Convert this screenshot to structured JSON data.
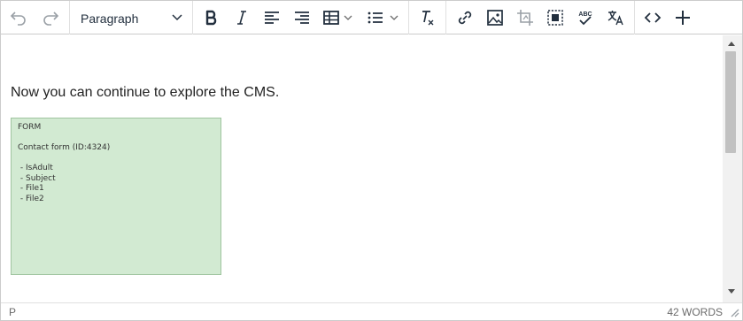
{
  "toolbar": {
    "block_format": "Paragraph",
    "buttons": [
      {
        "name": "undo",
        "icon": "undo-icon"
      },
      {
        "name": "redo",
        "icon": "redo-icon"
      },
      {
        "name": "bold",
        "icon": "bold-icon"
      },
      {
        "name": "italic",
        "icon": "italic-icon"
      },
      {
        "name": "align-left",
        "icon": "align-left-icon"
      },
      {
        "name": "align-right",
        "icon": "align-right-icon"
      },
      {
        "name": "table",
        "icon": "table-icon"
      },
      {
        "name": "bullet-list",
        "icon": "bullet-list-icon"
      },
      {
        "name": "clear-formatting",
        "icon": "clear-formatting-icon"
      },
      {
        "name": "link",
        "icon": "link-icon"
      },
      {
        "name": "image",
        "icon": "image-icon"
      },
      {
        "name": "crop",
        "icon": "crop-icon"
      },
      {
        "name": "select-all",
        "icon": "select-all-icon"
      },
      {
        "name": "spellcheck",
        "icon": "spellcheck-icon"
      },
      {
        "name": "translate",
        "icon": "translate-icon"
      },
      {
        "name": "source-code",
        "icon": "source-code-icon"
      },
      {
        "name": "insert",
        "icon": "plus-icon"
      }
    ],
    "icon_color": "#222f3e",
    "disabled_icon_color": "#9aa0a6"
  },
  "content": {
    "paragraph": "Now you can continue to explore the CMS.",
    "form_block": {
      "heading": "FORM",
      "form_name": "Contact form (ID:4324)",
      "fields": [
        "- IsAdult",
        "- Subject",
        "- File1",
        "- File2"
      ],
      "background_color": "#d2ead2"
    }
  },
  "statusbar": {
    "path": "P",
    "word_count": "42 WORDS"
  }
}
